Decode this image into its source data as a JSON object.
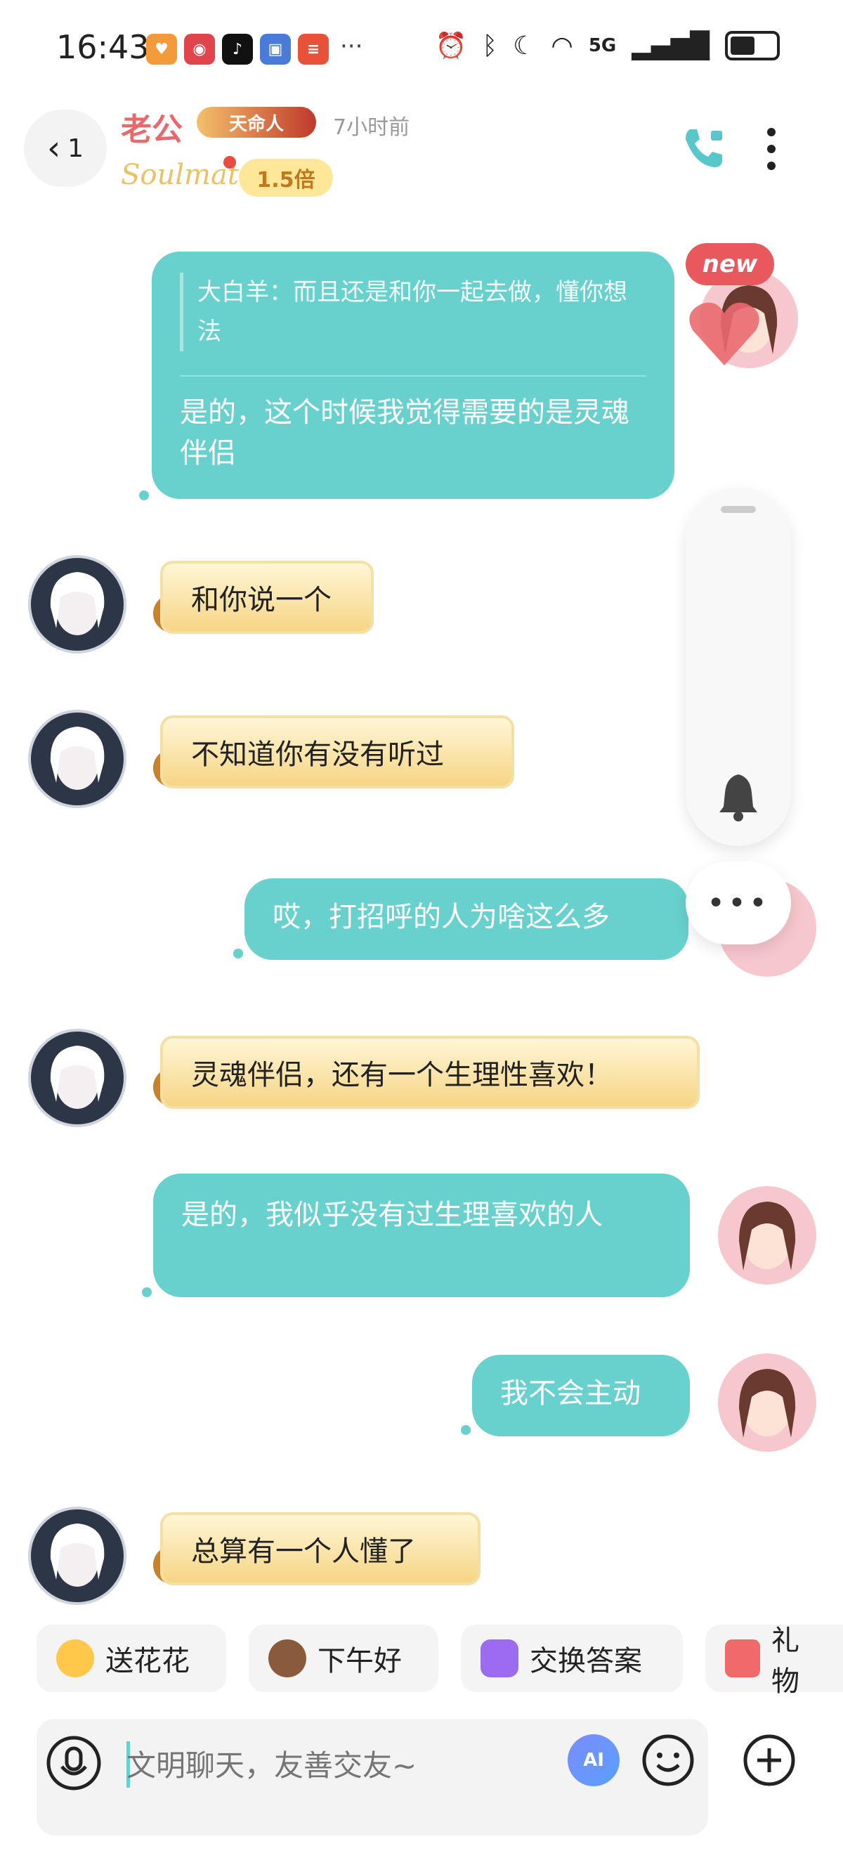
{
  "status_bar": {
    "time": "16:43",
    "network": "5G"
  },
  "header": {
    "back_count": "1",
    "contact_name": "老公",
    "badge_text": "天命人",
    "last_seen": "7小时前",
    "soulmate_label": "Soulmate",
    "multiplier": "1.5倍"
  },
  "messages": [
    {
      "side": "out",
      "quote": "大白羊：而且还是和你一起去做，懂你想法",
      "text": "是的，这个时候我觉得需要的是灵魂伴侣",
      "new_badge": "new"
    },
    {
      "side": "in",
      "text": "和你说一个"
    },
    {
      "side": "in",
      "text": "不知道你有没有听过"
    },
    {
      "side": "out",
      "text": "哎，打招呼的人为啥这么多"
    },
    {
      "side": "in",
      "text": "灵魂伴侣，还有一个生理性喜欢！"
    },
    {
      "side": "out",
      "text": "是的，我似乎没有过生理喜欢的人"
    },
    {
      "side": "out",
      "text": "我不会主动"
    },
    {
      "side": "in",
      "text": "总算有一个人懂了"
    }
  ],
  "quick_chips": [
    {
      "label": "送花花",
      "icon": "flower-face-icon"
    },
    {
      "label": "下午好",
      "icon": "coffee-icon"
    },
    {
      "label": "交换答案",
      "icon": "swap-chat-icon"
    },
    {
      "label": "礼物",
      "icon": "gift-icon"
    }
  ],
  "input": {
    "placeholder": "文明聊天，友善交友~",
    "ai_label": "AI"
  },
  "colors": {
    "accent": "#68d1cd",
    "name": "#e8686c",
    "incoming_bubble": "#f6d585"
  }
}
